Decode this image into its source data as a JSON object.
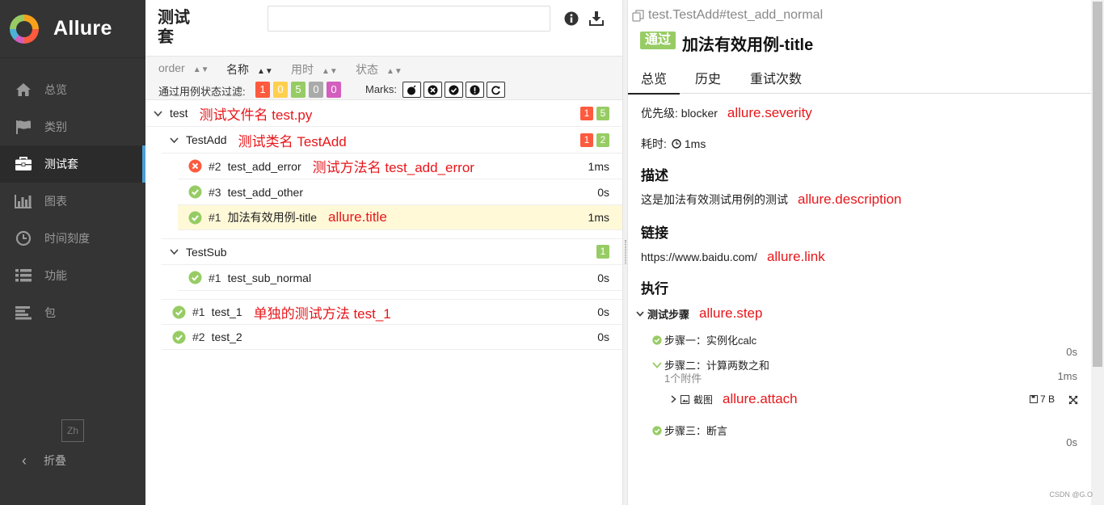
{
  "app": {
    "name": "Allure"
  },
  "colors": {
    "failed": "#fd5a3e",
    "broken": "#ffd050",
    "passed": "#97cc64",
    "skipped": "#aaaaaa",
    "unknown": "#d35ebe",
    "annotation": "#e8161a",
    "accent": "#4b9fd5"
  },
  "sidebar": {
    "items": [
      {
        "label": "总览",
        "icon": "home-icon"
      },
      {
        "label": "类别",
        "icon": "flag-icon"
      },
      {
        "label": "测试套",
        "icon": "briefcase-icon"
      },
      {
        "label": "图表",
        "icon": "bar-chart-icon"
      },
      {
        "label": "时间刻度",
        "icon": "clock-icon"
      },
      {
        "label": "功能",
        "icon": "list-icon"
      },
      {
        "label": "包",
        "icon": "align-left-icon"
      }
    ],
    "active_index": 2,
    "lang": "Zh",
    "collapse_label": "折叠"
  },
  "middle": {
    "title": "测试套",
    "search": {
      "value": "",
      "placeholder": ""
    },
    "sort": {
      "order": "order",
      "name": "名称",
      "duration": "用时",
      "status": "状态"
    },
    "filter": {
      "label": "通过用例状态过滤:",
      "counts": [
        "1",
        "0",
        "5",
        "0",
        "0"
      ]
    },
    "marks_label": "Marks:",
    "tree": {
      "suite_test": {
        "name": "test",
        "anno": "测试文件名 test.py",
        "failed": "1",
        "passed": "5"
      },
      "testadd": {
        "name": "TestAdd",
        "anno": "测试类名 TestAdd",
        "failed": "1",
        "passed": "2"
      },
      "case_error": {
        "num": "#2",
        "name": "test_add_error",
        "anno": "测试方法名 test_add_error",
        "duration": "1ms"
      },
      "case_other": {
        "num": "#3",
        "name": "test_add_other",
        "duration": "0s"
      },
      "case_title": {
        "num": "#1",
        "name": "加法有效用例-title",
        "anno": "allure.title",
        "duration": "1ms"
      },
      "testsub": {
        "name": "TestSub",
        "passed": "1"
      },
      "case_sub": {
        "num": "#1",
        "name": "test_sub_normal",
        "duration": "0s"
      },
      "case_t1": {
        "num": "#1",
        "name": "test_1",
        "anno": "单独的测试方法 test_1",
        "duration": "0s"
      },
      "case_t2": {
        "num": "#2",
        "name": "test_2",
        "duration": "0s"
      }
    }
  },
  "detail": {
    "path": "test.TestAdd#test_add_normal",
    "status": "通过",
    "title": "加法有效用例-title",
    "tabs": [
      "总览",
      "历史",
      "重试次数"
    ],
    "severity": {
      "label": "优先级: blocker",
      "anno": "allure.severity"
    },
    "duration": {
      "label": "耗时:",
      "value": "1ms"
    },
    "description_head": "描述",
    "description": {
      "text": "这是加法有效测试用例的测试",
      "anno": "allure.description"
    },
    "links_head": "链接",
    "link": {
      "text": "https://www.baidu.com/",
      "anno": "allure.link"
    },
    "exec_head": "执行",
    "steps_group": {
      "label": "测试步骤",
      "anno": "allure.step"
    },
    "step1": {
      "label": "步骤一：实例化calc",
      "duration": "0s"
    },
    "step2": {
      "label": "步骤二：计算两数之和",
      "sub": "1个附件",
      "duration": "1ms"
    },
    "attachment": {
      "label": "截图",
      "anno": "allure.attach",
      "size": "7 B"
    },
    "step3": {
      "label": "步骤三：断言",
      "duration": "0s"
    }
  },
  "watermark": "CSDN @G.O"
}
